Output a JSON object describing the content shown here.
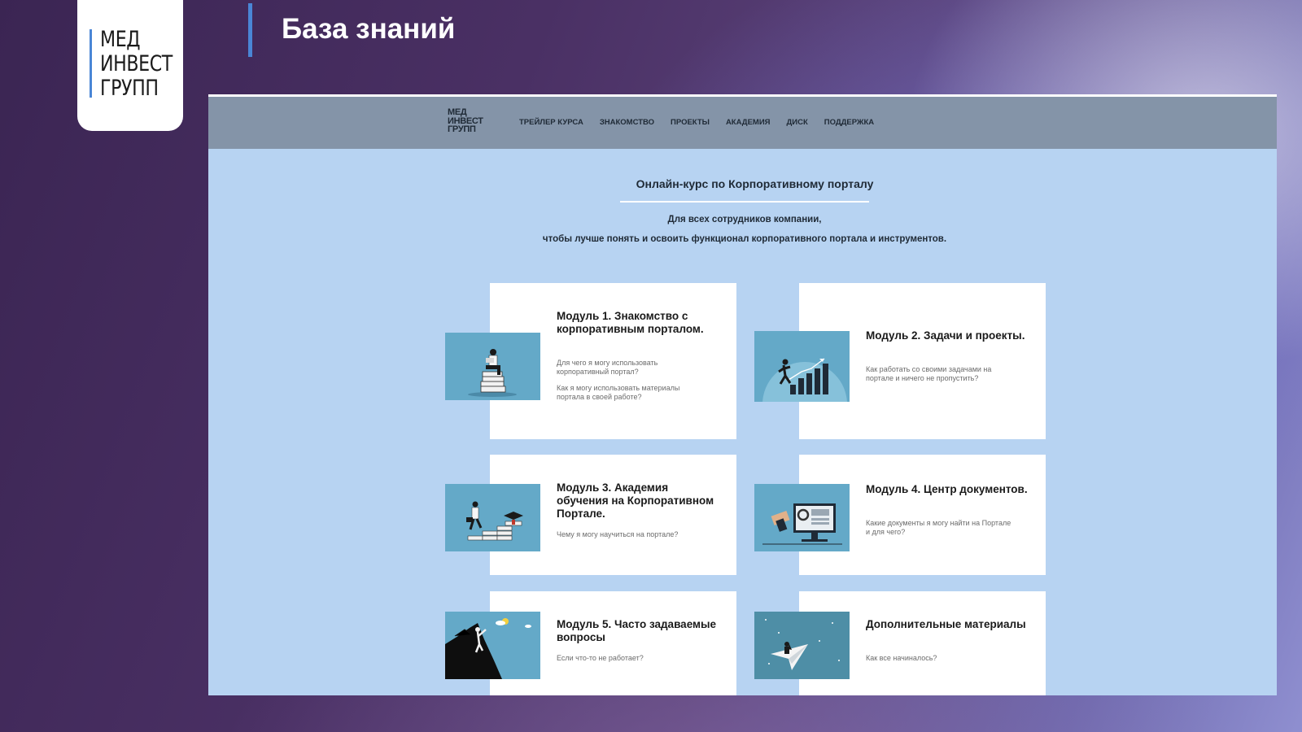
{
  "logo": {
    "line1": "МЕД",
    "line2": "ИНВЕСТ",
    "line3": "ГРУПП"
  },
  "slide_title": "База знаний",
  "site": {
    "logo": {
      "line1": "МЕД",
      "line2": "ИНВЕСТ",
      "line3": "ГРУПП"
    },
    "nav": [
      "ТРЕЙЛЕР КУРСА",
      "ЗНАКОМСТВО",
      "ПРОЕКТЫ",
      "АКАДЕМИЯ",
      "ДИСК",
      "ПОДДЕРЖКА"
    ],
    "course_title": "Онлайн-курс по Корпоративному порталу",
    "subtitle_line1": "Для всех сотрудников компании,",
    "subtitle_line2": "чтобы лучше понять и освоить функционал корпоративного портала и инструментов."
  },
  "modules": [
    {
      "title": "Модуль 1. Знакомство с корпоративным порталом.",
      "desc1": "Для чего я могу использовать корпоративный портал?",
      "desc2": "Как я могу использовать материалы портала в своей работе?",
      "image": "person-reading-on-books"
    },
    {
      "title": "Модуль 2. Задачи и проекты.",
      "desc1": "Как работать со своими задачами на портале и ничего не пропустить?",
      "desc2": "",
      "image": "person-running-bar-chart"
    },
    {
      "title": "Модуль 3. Академия обучения на Корпоративном Портале.",
      "desc1": "Чему я могу научиться на портале?",
      "desc2": "",
      "image": "person-climbing-stairs-graduation"
    },
    {
      "title": "Модуль 4. Центр документов.",
      "desc1": "Какие документы я могу найти на Портале и для чего?",
      "desc2": "",
      "image": "monitor-documents"
    },
    {
      "title": "Модуль 5. Часто задаваемые вопросы",
      "desc1": "Если что-то не работает?",
      "desc2": "",
      "image": "person-climbing-mountain"
    },
    {
      "title": "Дополнительные материалы",
      "desc1": "Как все начиналось?",
      "desc2": "",
      "image": "person-on-paper-plane"
    }
  ],
  "colors": {
    "accent": "#4a86d6",
    "page_bg": "#b7d3f2",
    "navbar": "#8494a8",
    "thumb_bg": "#64a9c8"
  }
}
